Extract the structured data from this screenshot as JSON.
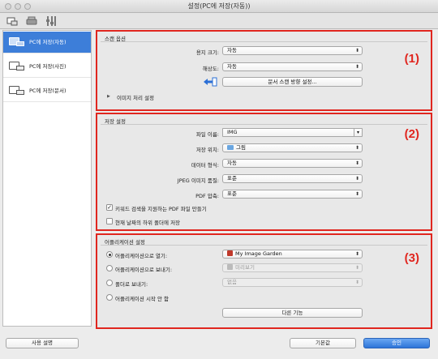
{
  "window": {
    "title": "설정(PC에 저장(자동))"
  },
  "sidebar": {
    "items": [
      {
        "label": "PC에 저장(자동)",
        "active": true,
        "icon": "pc-scan-auto-icon"
      },
      {
        "label": "PC에 저장(사진)",
        "active": false,
        "icon": "pc-scan-photo-icon"
      },
      {
        "label": "PC에 저장(문서)",
        "active": false,
        "icon": "pc-scan-document-icon"
      }
    ]
  },
  "scan_options": {
    "title": "스캔 옵션",
    "marker": "(1)",
    "paper_size_label": "용지 크기:",
    "paper_size_value": "자동",
    "resolution_label": "해상도:",
    "resolution_value": "자동",
    "orientation_button": "문서 스캔 방향 설정...",
    "image_processing_label": "이미지 처리 설정"
  },
  "save_settings": {
    "title": "저장 설정",
    "marker": "(2)",
    "file_name_label": "파일 이름:",
    "file_name_value": "IMG",
    "save_in_label": "저장 위치:",
    "save_in_value": "그림",
    "data_format_label": "데이터 형식:",
    "data_format_value": "자동",
    "jpeg_quality_label": "JPEG 이미지 품질:",
    "jpeg_quality_value": "표준",
    "pdf_compression_label": "PDF 압축:",
    "pdf_compression_value": "표준",
    "keyword_pdf_label": "키워드 검색을 지원하는 PDF 파일 만들기",
    "keyword_pdf_checked": true,
    "subfolder_label": "현재 날짜의 하위 폴더에 저장",
    "subfolder_checked": false
  },
  "app_settings": {
    "title": "어플리케이션 설정",
    "marker": "(3)",
    "open_app_label": "어플리케이션으로 열기:",
    "open_app_value": "My Image Garden",
    "send_app_label": "어플리케이션으로 보내기:",
    "send_app_value": "미리보기",
    "send_folder_label": "폴더로 보내기:",
    "send_folder_value": "없음",
    "no_app_label": "어플리케이션 시작 안 함",
    "more_button": "다른 기능",
    "selected_option": "open_app"
  },
  "footer": {
    "help_button": "사용 설명",
    "defaults_button": "기본값",
    "ok_button": "승인"
  },
  "colors": {
    "accent": "#3d7ed9",
    "highlight": "#e0261f"
  }
}
